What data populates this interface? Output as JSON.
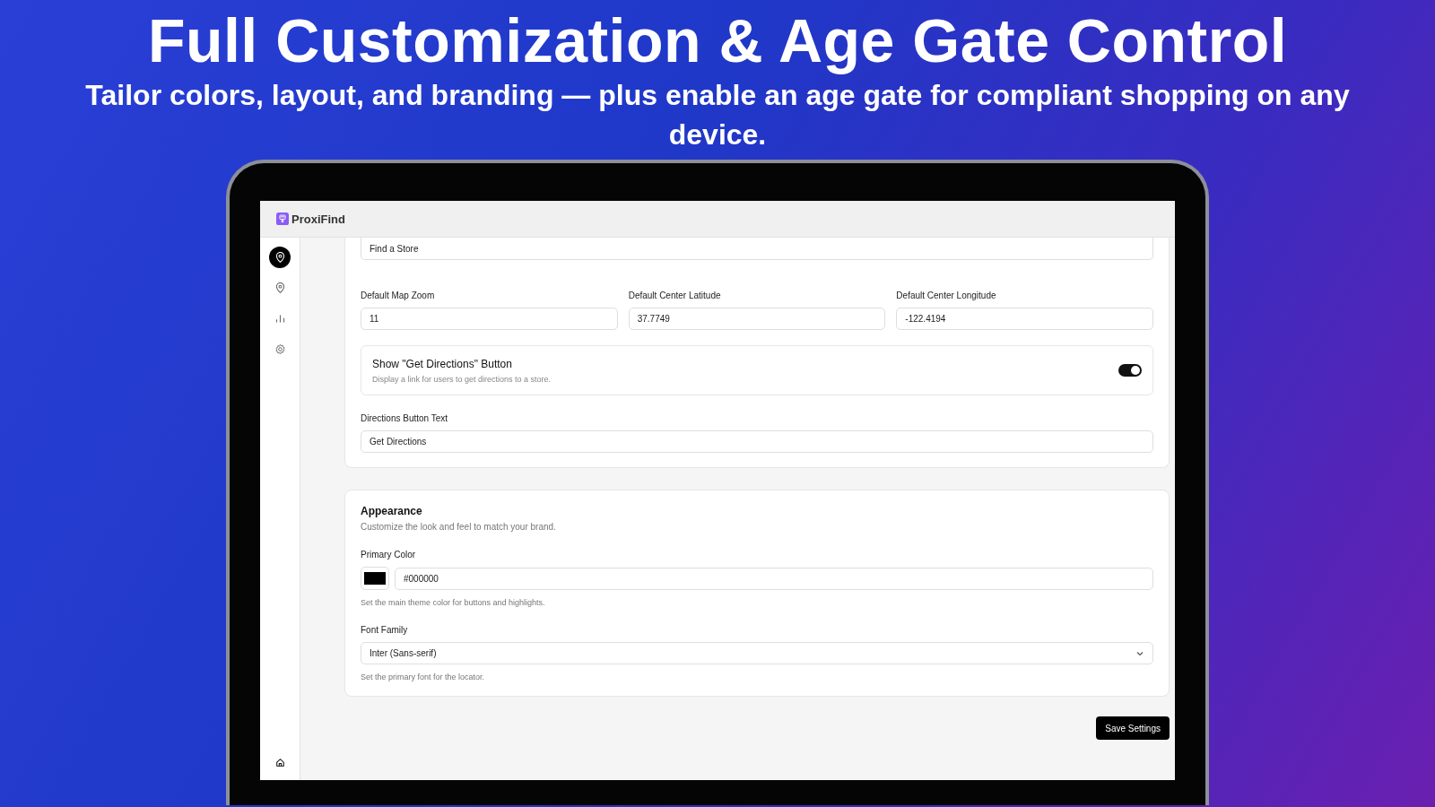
{
  "headline": "Full Customization & Age Gate Control",
  "subheadline": "Tailor colors, layout, and branding — plus enable an age gate for compliant shopping on any device.",
  "app": {
    "name": "ProxiFind"
  },
  "sidebar": {
    "items": [
      {
        "kind": "pin",
        "selected": true
      },
      {
        "kind": "pin",
        "selected": false
      },
      {
        "kind": "chart",
        "selected": false
      },
      {
        "kind": "gear",
        "selected": false
      }
    ],
    "bottom_item": {
      "kind": "home"
    }
  },
  "general_card": {
    "top_field": {
      "value": "Find a Store"
    },
    "map_fields": [
      {
        "label": "Default Map Zoom",
        "value": "11"
      },
      {
        "label": "Default Center Latitude",
        "value": "37.7749"
      },
      {
        "label": "Default Center Longitude",
        "value": "-122.4194"
      }
    ],
    "toggle": {
      "title": "Show \"Get Directions\" Button",
      "description": "Display a link for users to get directions to a store.",
      "on": true
    },
    "directions_field": {
      "label": "Directions Button Text",
      "value": "Get Directions"
    }
  },
  "appearance_card": {
    "title": "Appearance",
    "description": "Customize the look and feel to match your brand.",
    "primary_color": {
      "label": "Primary Color",
      "value": "#000000",
      "help": "Set the main theme color for buttons and highlights."
    },
    "font_family": {
      "label": "Font Family",
      "value": "Inter (Sans-serif)",
      "help": "Set the primary font for the locator."
    }
  },
  "save_button": "Save Settings"
}
